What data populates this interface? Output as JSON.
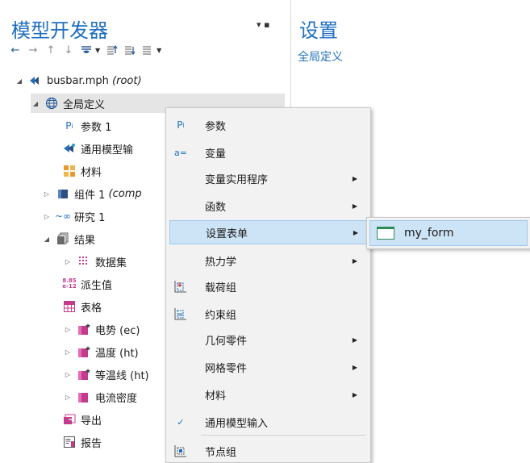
{
  "left_pane": {
    "title": "模型开发器",
    "pin_controls": "▾ ▪"
  },
  "right_pane": {
    "title": "设置",
    "subtitle": "全局定义"
  },
  "toolbar": {
    "items": [
      "back-arrow-icon",
      "forward-arrow-icon",
      "up-arrow-icon",
      "down-arrow-icon",
      "show-options-icon",
      "collapse-all-icon",
      "expand-all-icon",
      "list-icon"
    ]
  },
  "tree": {
    "root_name": "busbar.mph",
    "root_suffix": "(root)",
    "global_definitions": "全局定义",
    "parameters": "参数 1",
    "common_model_input": "通用模型输",
    "materials": "材料",
    "component_prefix": "组件 1",
    "component_suffix": "(comp",
    "study": "研究 1",
    "results": "结果",
    "datasets": "数据集",
    "derived_values": "派生值",
    "tables": "表格",
    "potential": "电势 (ec)",
    "temperature": "温度 (ht)",
    "isothermal": "等温线 (ht)",
    "current_density": "电流密度",
    "export": "导出",
    "reports": "报告",
    "pi_glyph": "P",
    "pi_sub": "i",
    "counter_glyph_top": "8.85",
    "counter_glyph_bot": "e-12"
  },
  "context_menu": {
    "items": [
      {
        "label": "参数",
        "icon": "Pi"
      },
      {
        "label": "变量",
        "icon": "a="
      },
      {
        "label": "变量实用程序",
        "has_submenu": true
      },
      {
        "label": "函数",
        "has_submenu": true
      },
      {
        "label": "设置表单",
        "has_submenu": true,
        "highlighted": true
      },
      {
        "label": "热力学",
        "has_submenu": true
      },
      {
        "label": "载荷组"
      },
      {
        "label": "约束组"
      },
      {
        "label": "几何零件",
        "has_submenu": true
      },
      {
        "label": "网格零件",
        "has_submenu": true
      },
      {
        "label": "材料",
        "has_submenu": true
      },
      {
        "label": "通用模型输入",
        "checked": true
      },
      {
        "label": "节点组"
      }
    ],
    "check_mark": "✓",
    "arrow": "▶"
  },
  "submenu": {
    "item_label": "my_form"
  },
  "colors": {
    "accent_blue": "#1f6fc0",
    "highlight": "#cde4f7",
    "menu_bg": "#f2f2f2"
  }
}
